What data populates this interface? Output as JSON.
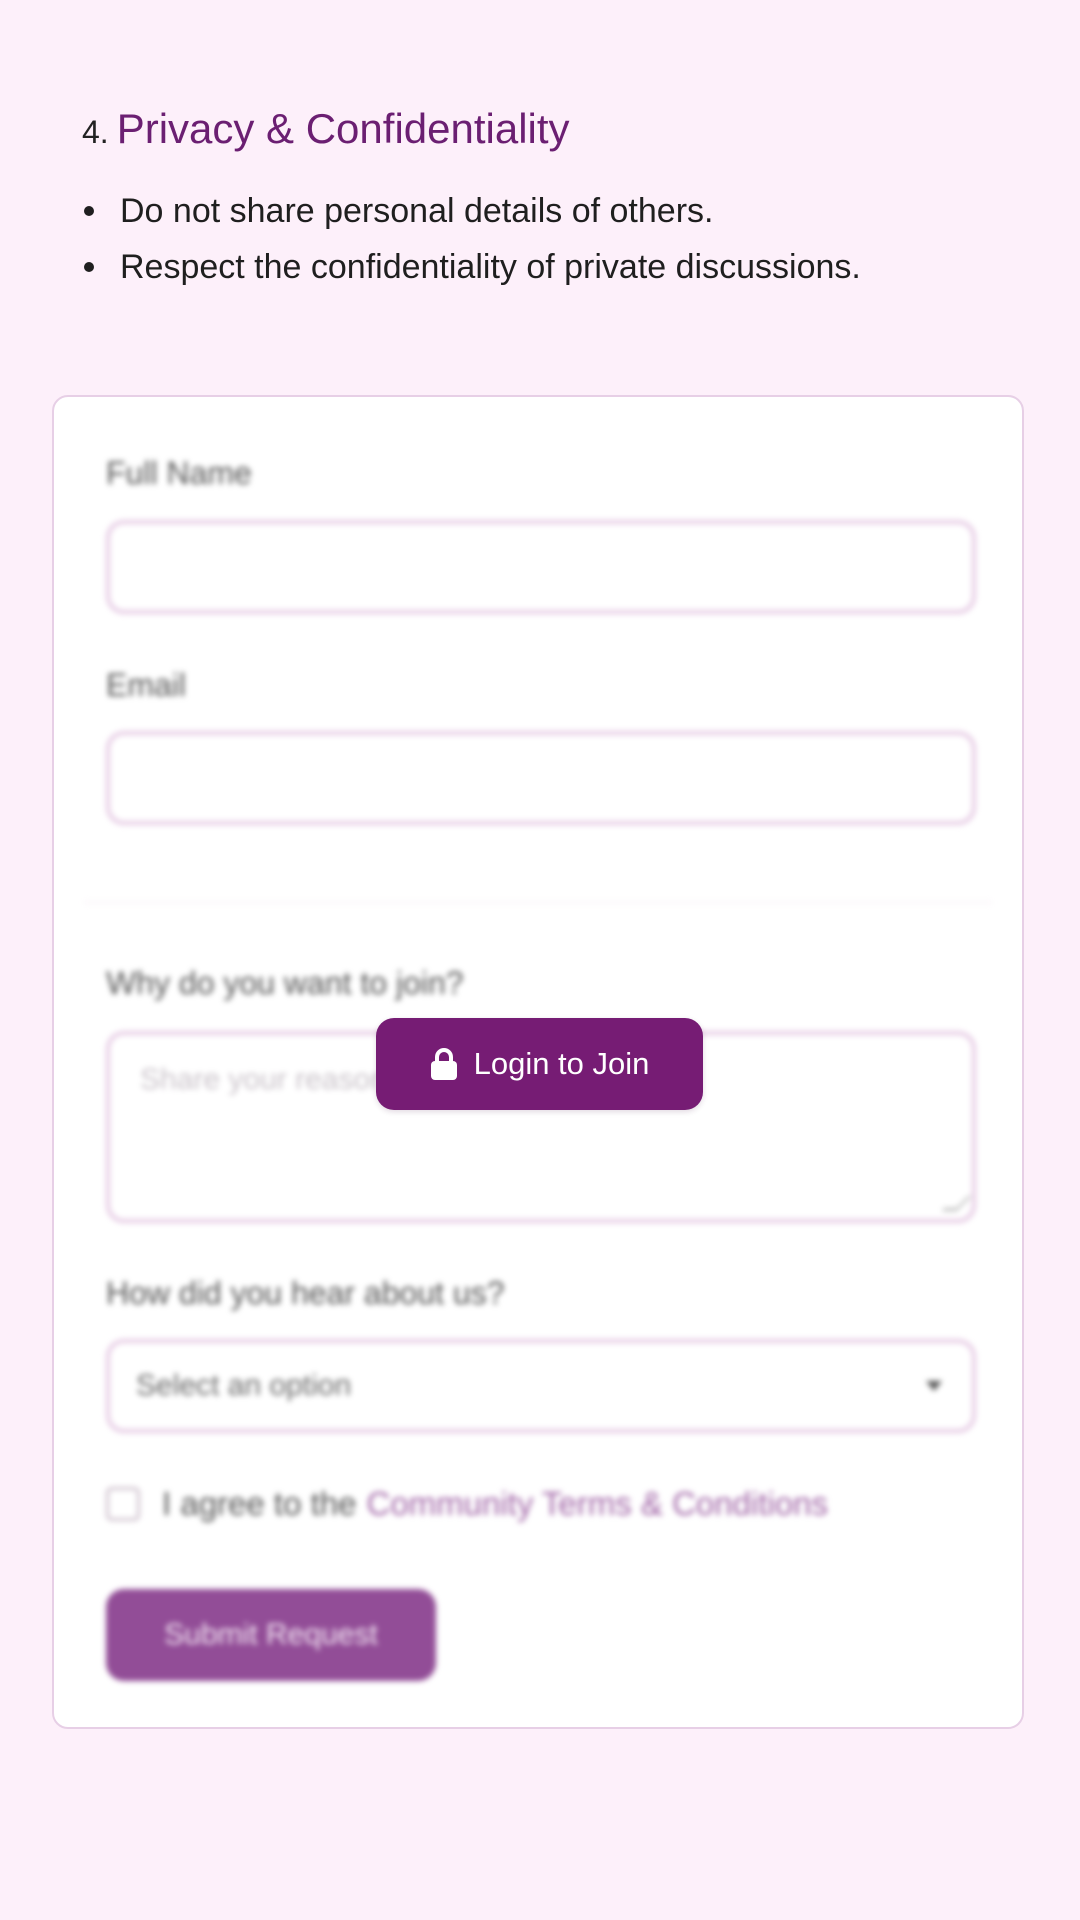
{
  "section": {
    "number": "4.",
    "title": "Privacy & Confidentiality",
    "rules": [
      "Do not share personal details of others.",
      "Respect the confidentiality of private discussions."
    ]
  },
  "form": {
    "full_name_label": "Full Name",
    "full_name_value": "",
    "email_label": "Email",
    "email_value": "",
    "reason_label": "Why do you want to join?",
    "reason_placeholder": "Share your reasons...",
    "source_label": "How did you hear about us?",
    "source_selected": "Select an option",
    "terms_prefix": "I agree to the",
    "terms_link": "Community Terms & Conditions",
    "submit_label": "Submit Request"
  },
  "overlay": {
    "login_label": "Login to Join",
    "icon": "lock-icon"
  },
  "colors": {
    "background": "#fdf0fa",
    "accent": "#6b1f72",
    "login_button": "#761c74",
    "submit_button": "#924d97"
  }
}
